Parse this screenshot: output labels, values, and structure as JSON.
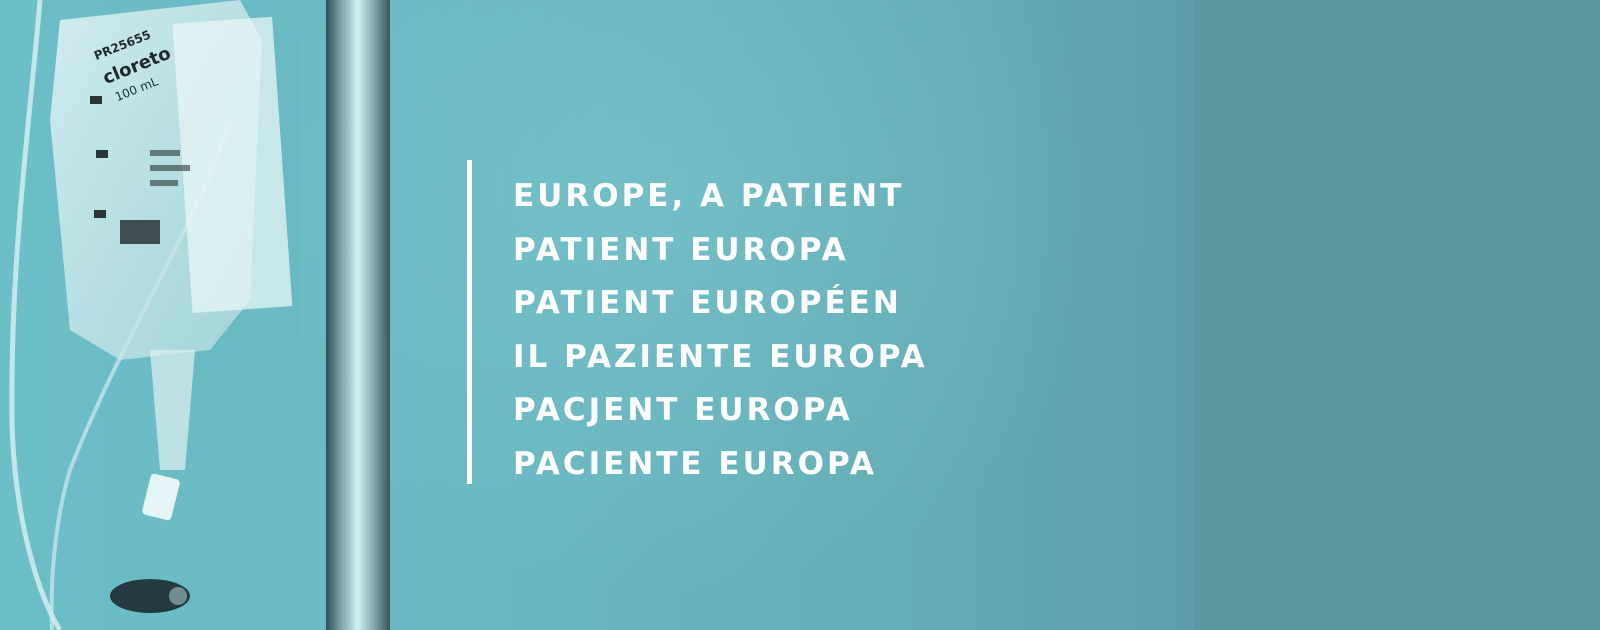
{
  "hero": {
    "title_lines": [
      "EUROPE, A PATIENT",
      "PATIENT EUROPA",
      "PATIENT EUROPÉEN",
      "IL PAZIENTE EUROPA",
      "PACJENT EUROPA",
      "PACIENTE EUROPA"
    ],
    "photo": {
      "subject": "iv-drip-bag-and-pole",
      "bag_label_text": [
        "PR25655",
        "cloreto",
        "100 mL"
      ]
    },
    "colors": {
      "background": "#68b6c0",
      "right_panel": "#5b98a1",
      "text": "#ffffff",
      "rule": "#ffffff"
    }
  }
}
